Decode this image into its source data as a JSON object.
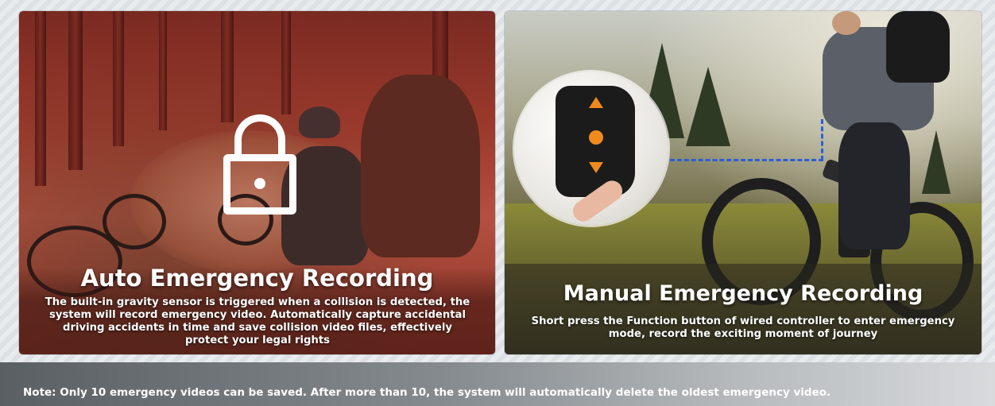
{
  "left_panel": {
    "title": "Auto Emergency Recording",
    "description": "The built-in gravity sensor is triggered when a collision is detected, the system will record emergency video. Automatically capture accidental driving accidents in time and save collision video files, effectively protect your legal rights",
    "icon": "lock-icon",
    "overlay_color": "#b23a2e"
  },
  "right_panel": {
    "title": "Manual Emergency Recording",
    "description": "Short press the Function button of wired controller to enter emergency mode, record the exciting moment of journey",
    "icon": "controller-icon",
    "accent_color": "#f08a1c",
    "pointer_color": "#2b5fd6"
  },
  "footer": {
    "note": "Note: Only 10 emergency videos can be saved. After more than 10, the system will automatically delete the oldest emergency video."
  }
}
